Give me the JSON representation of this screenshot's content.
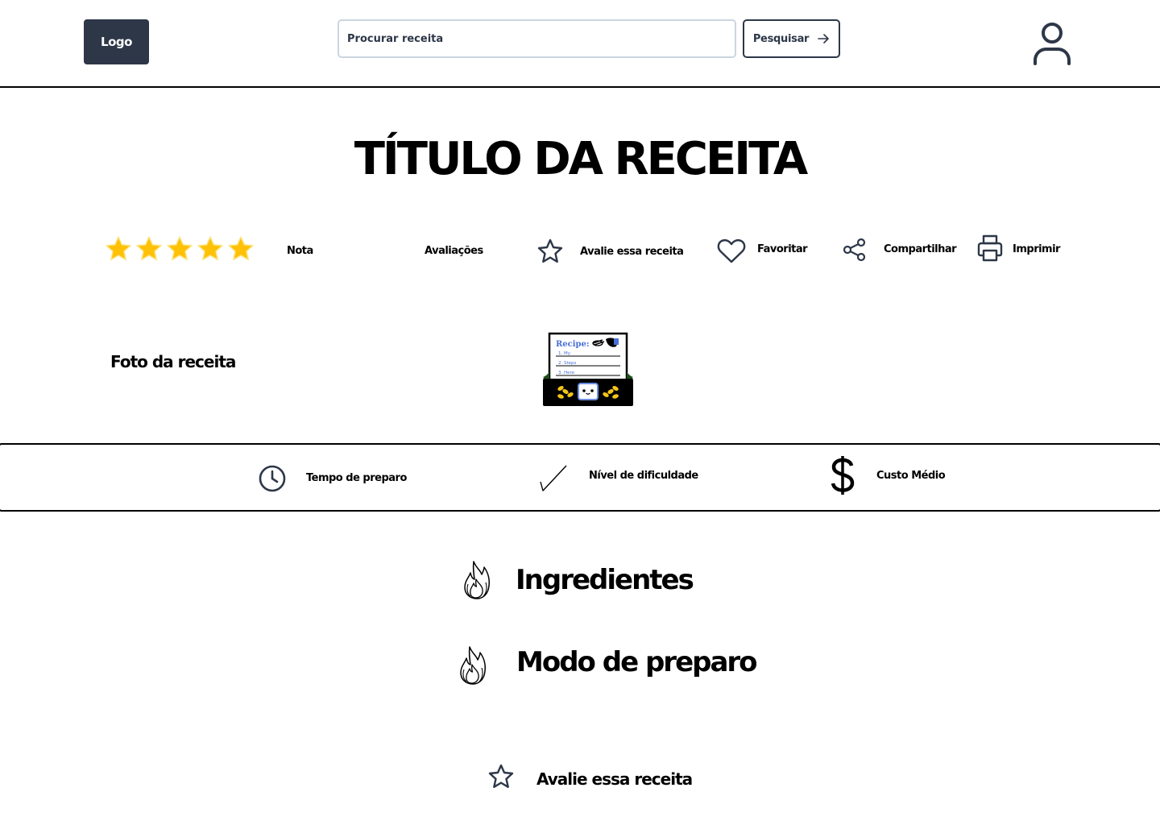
{
  "header": {
    "logo_label": "Logo",
    "search_placeholder": "Procurar receita",
    "search_button_label": "Pesquisar"
  },
  "recipe": {
    "title": "TÍTULO DA RECEITA",
    "rating_stars": 5,
    "rating_label": "Nota",
    "reviews_label": "Avaliações",
    "photo_label": "Foto da receita",
    "image_text": {
      "heading": "Recipe:",
      "line1": "1. My",
      "line2": "2. Steps",
      "line3": "3. Here"
    }
  },
  "actions": {
    "rate_label": "Avalie essa receita",
    "favorite_label": "Favoritar",
    "share_label": "Compartilhar",
    "print_label": "Imprimir"
  },
  "info_bar": {
    "prep_time_label": "Tempo de preparo",
    "difficulty_label": "Nível de dificuldade",
    "cost_label": "Custo Médio"
  },
  "sections": {
    "ingredients_title": "Ingredientes",
    "method_title": "Modo de preparo"
  },
  "footer": {
    "rate_label": "Avalie essa receita"
  },
  "colors": {
    "dark": "#2d3748",
    "input_border": "#cbd5e0",
    "star": "#ffc107",
    "text": "#000000"
  }
}
